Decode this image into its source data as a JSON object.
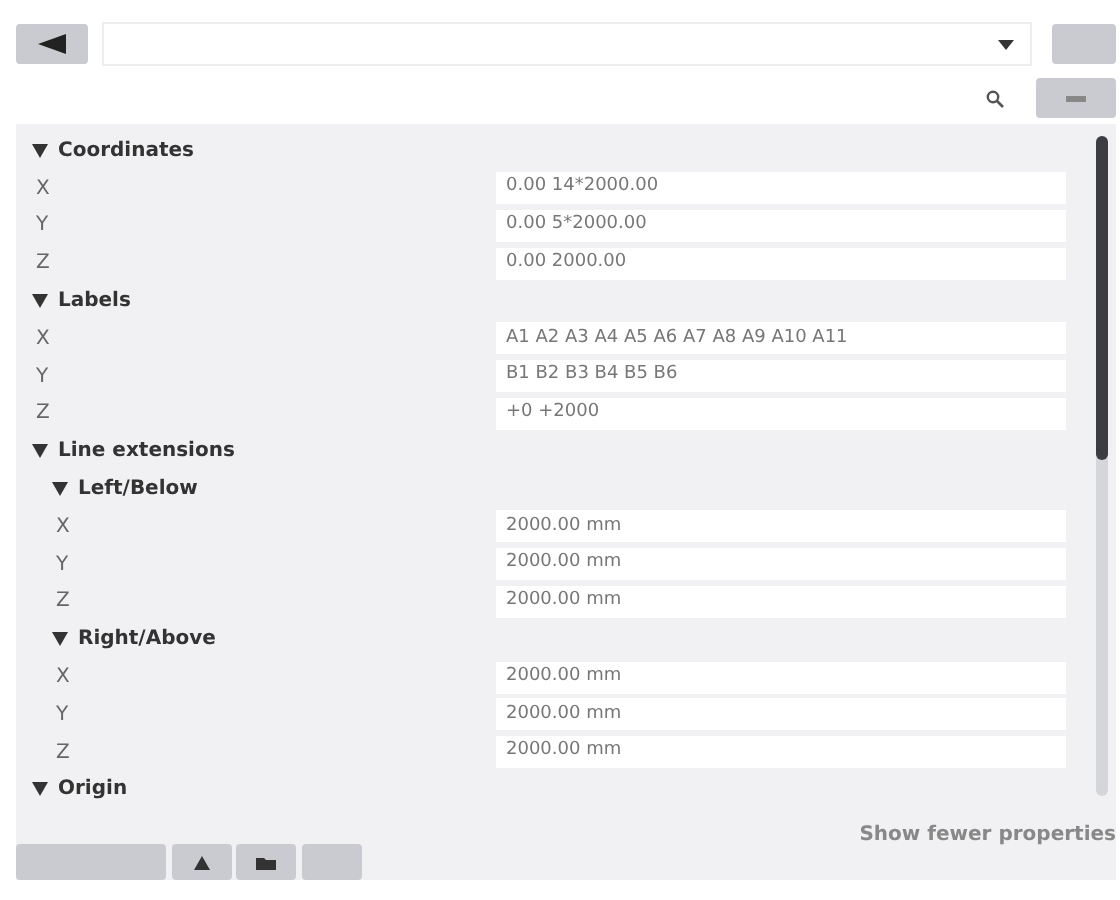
{
  "properties": [
    {
      "kind": "group",
      "label": "Coordinates",
      "expanded": true,
      "children": [
        {
          "kind": "field",
          "label": "X",
          "value": "0.00 14*2000.00"
        },
        {
          "kind": "field",
          "label": "Y",
          "value": "0.00 5*2000.00"
        },
        {
          "kind": "field",
          "label": "Z",
          "value": "0.00 2000.00"
        }
      ]
    },
    {
      "kind": "group",
      "label": "Labels",
      "expanded": true,
      "children": [
        {
          "kind": "field",
          "label": "X",
          "value": "A1 A2 A3 A4 A5 A6 A7 A8 A9 A10 A11"
        },
        {
          "kind": "field",
          "label": "Y",
          "value": "B1 B2 B3 B4 B5 B6"
        },
        {
          "kind": "field",
          "label": "Z",
          "value": "+0 +2000"
        }
      ]
    },
    {
      "kind": "group",
      "label": "Line extensions",
      "expanded": true,
      "children": [
        {
          "kind": "group",
          "label": "Left/Below",
          "expanded": true,
          "children": [
            {
              "kind": "field",
              "label": "X",
              "value": "2000.00 mm"
            },
            {
              "kind": "field",
              "label": "Y",
              "value": "2000.00 mm"
            },
            {
              "kind": "field",
              "label": "Z",
              "value": "2000.00 mm"
            }
          ]
        },
        {
          "kind": "group",
          "label": "Right/Above",
          "expanded": true,
          "children": [
            {
              "kind": "field",
              "label": "X",
              "value": "2000.00 mm"
            },
            {
              "kind": "field",
              "label": "Y",
              "value": "2000.00 mm"
            },
            {
              "kind": "field",
              "label": "Z",
              "value": "2000.00 mm"
            }
          ]
        }
      ]
    },
    {
      "kind": "group",
      "label": "Origin",
      "expanded": true
    }
  ],
  "footer_link": "Show fewer properties"
}
